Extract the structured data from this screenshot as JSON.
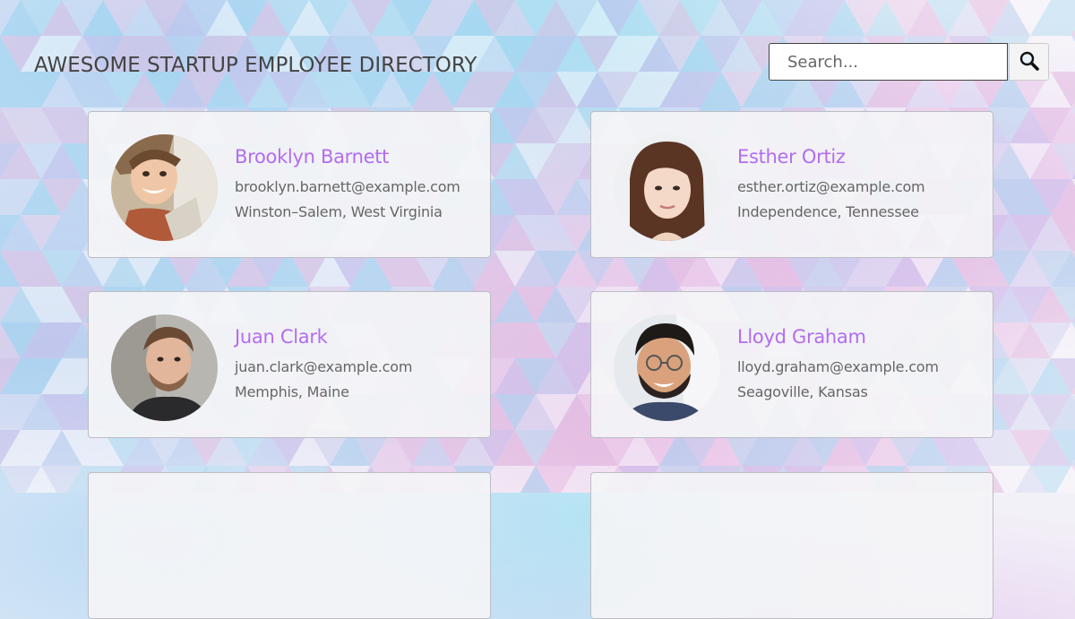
{
  "header": {
    "title": "AWESOME STARTUP EMPLOYEE DIRECTORY",
    "search_placeholder": "Search...",
    "search_button_icon": "magnifier-icon"
  },
  "employees": [
    {
      "name": "Brooklyn Barnett",
      "email": "brooklyn.barnett@example.com",
      "location": "Winston–Salem, West Virginia"
    },
    {
      "name": "Esther Ortiz",
      "email": "esther.ortiz@example.com",
      "location": "Independence, Tennessee"
    },
    {
      "name": "Juan Clark",
      "email": "juan.clark@example.com",
      "location": "Memphis, Maine"
    },
    {
      "name": "Lloyd Graham",
      "email": "lloyd.graham@example.com",
      "location": "Seagoville, Kansas"
    },
    {
      "name": "",
      "email": "",
      "location": ""
    },
    {
      "name": "",
      "email": "",
      "location": ""
    }
  ],
  "colors": {
    "name_accent": "#b36cf0",
    "text": "#666666",
    "title": "#444444"
  }
}
